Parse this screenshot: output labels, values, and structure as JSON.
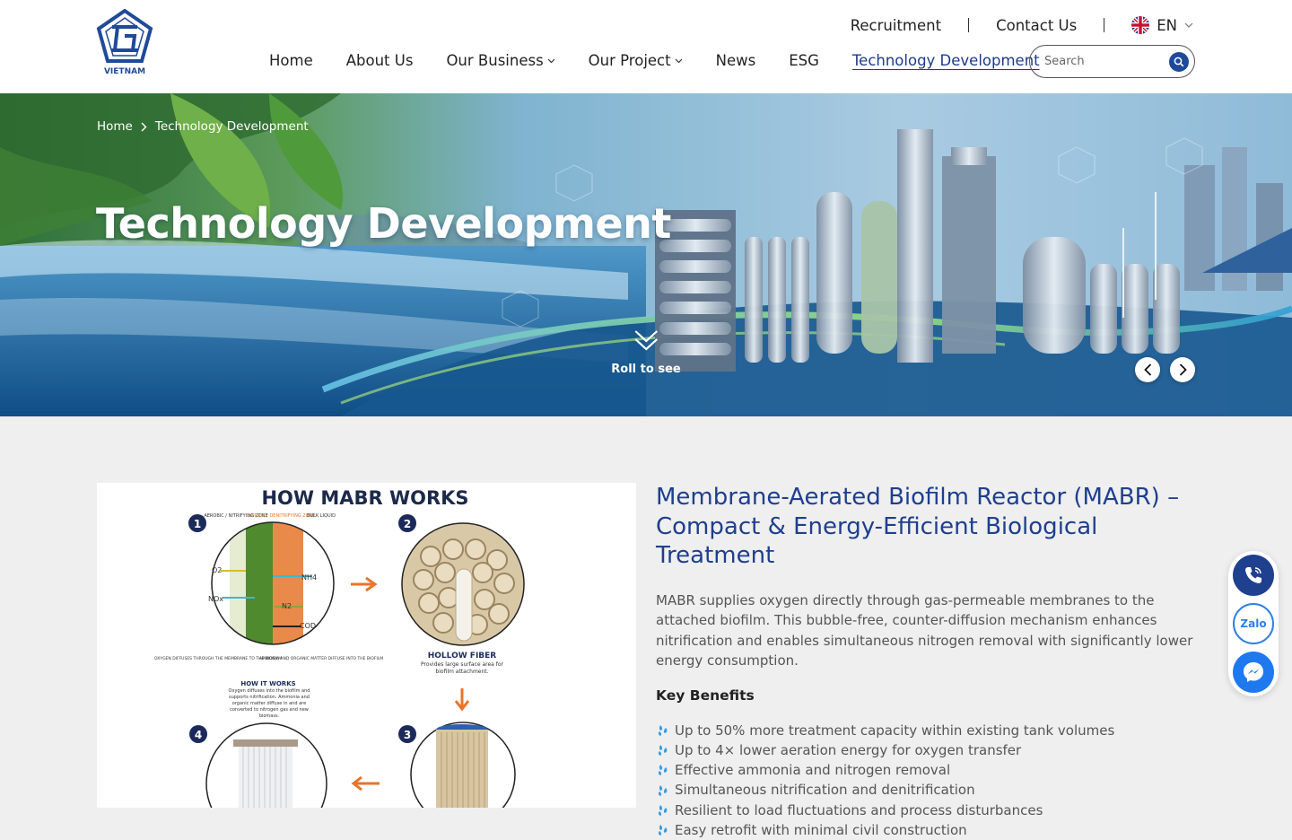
{
  "header": {
    "logo_text": "VIETNAM",
    "top_links": [
      "Recruitment",
      "Contact Us"
    ],
    "language": "EN",
    "nav": [
      {
        "label": "Home",
        "dropdown": false
      },
      {
        "label": "About Us",
        "dropdown": false
      },
      {
        "label": "Our Business",
        "dropdown": true
      },
      {
        "label": "Our Project",
        "dropdown": true
      },
      {
        "label": "News",
        "dropdown": false
      },
      {
        "label": "ESG",
        "dropdown": false
      },
      {
        "label": "Technology Development",
        "dropdown": false,
        "active": true
      }
    ],
    "search_placeholder": "Search"
  },
  "hero": {
    "breadcrumb": [
      "Home",
      "Technology Development"
    ],
    "title": "Technology Development",
    "scroll_hint": "Roll to see"
  },
  "figure": {
    "title": "HOW MABR WORKS",
    "steps": [
      "1",
      "2",
      "3",
      "4"
    ],
    "zone_labels": [
      "AEROBIC / NITRIFYING ZONE",
      "ANOXIC / DENITRIFYING ZONE",
      "BULK LIQUID"
    ],
    "chem_labels": [
      "O2",
      "NOx",
      "NH4",
      "N2",
      "COD"
    ],
    "bottom_labels": [
      "OXYGEN DIFFUSES THROUGH THE MEMBRANE TO THE BIOFILM",
      "AMMONIA AND ORGANIC MATTER DIFFUSE INTO THE BIOFILM"
    ],
    "how_title": "HOW IT WORKS",
    "how_text": "Oxygen diffuses into the biofilm and supports nitrification. Ammonia and organic matter diffuse in and are converted to nitrogen gas and new biomass.",
    "fiber_title": "HOLLOW FIBER",
    "fiber_text": "Provides large surface area for biofilm attachment."
  },
  "content": {
    "heading": "Membrane-Aerated Biofilm Reactor (MABR) – Compact & Energy-Efficient Biological Treatment",
    "description": "MABR supplies oxygen directly through gas-permeable membranes to the attached biofilm. This bubble-free, counter-diffusion mechanism enhances nitrification and enables simultaneous nitrogen removal with significantly lower energy consumption.",
    "key_benefits_title": "Key Benefits",
    "benefits": [
      "Up to 50% more treatment capacity within existing tank volumes",
      "Up to 4× lower aeration energy for oxygen transfer",
      "Effective ammonia and nitrogen removal",
      "Simultaneous nitrification and denitrification",
      "Resilient to load fluctuations and process disturbances",
      "Easy retrofit with minimal civil construction"
    ]
  },
  "floating_contacts": {
    "zalo_label": "Zalo"
  },
  "colors": {
    "brand_blue": "#1e3f8f",
    "accent_orange": "#e8742a"
  }
}
